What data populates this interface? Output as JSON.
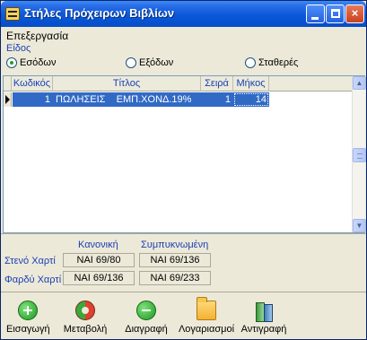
{
  "window": {
    "title": "Στήλες Πρόχειρων Βιβλίων",
    "buttons": {
      "minimize": "minimize",
      "maximize": "maximize",
      "close": "×"
    }
  },
  "menu": {
    "label": "Επεξεργασία"
  },
  "type_group": {
    "label": "Είδος",
    "options": [
      {
        "label": "Εσόδων",
        "selected": true
      },
      {
        "label": "Εξόδων",
        "selected": false
      },
      {
        "label": "Σταθερές",
        "selected": false
      }
    ]
  },
  "table": {
    "columns": [
      "Κωδικός",
      "Τίτλος",
      "Σειρά",
      "Μήκος"
    ],
    "rows": [
      {
        "code": "1",
        "title": "ΠΩΛΗΣΕΙΣ    ΕΜΠ.ΧΟΝΔ.19%",
        "order": "1",
        "length": "14"
      }
    ]
  },
  "paper": {
    "col_headers": {
      "normal": "Κανονική",
      "condensed": "Συμπυκνωμένη"
    },
    "rows": [
      {
        "label": "Στενό Χαρτί",
        "normal": "ΝΑΙ 69/80",
        "condensed": "ΝΑΙ 69/136"
      },
      {
        "label": "Φαρδύ Χαρτί",
        "normal": "ΝΑΙ 69/136",
        "condensed": "ΝΑΙ 69/233"
      }
    ]
  },
  "toolbar": {
    "add": "Εισαγωγή",
    "edit": "Μεταβολή",
    "delete": "Διαγραφή",
    "accounts": "Λογαριασμοί",
    "copy": "Αντιγραφή"
  },
  "colors": {
    "titlebar": "#0a58d8",
    "selection": "#316ac5",
    "label_blue": "#1a3fb5",
    "window_bg": "#ece9d8"
  }
}
